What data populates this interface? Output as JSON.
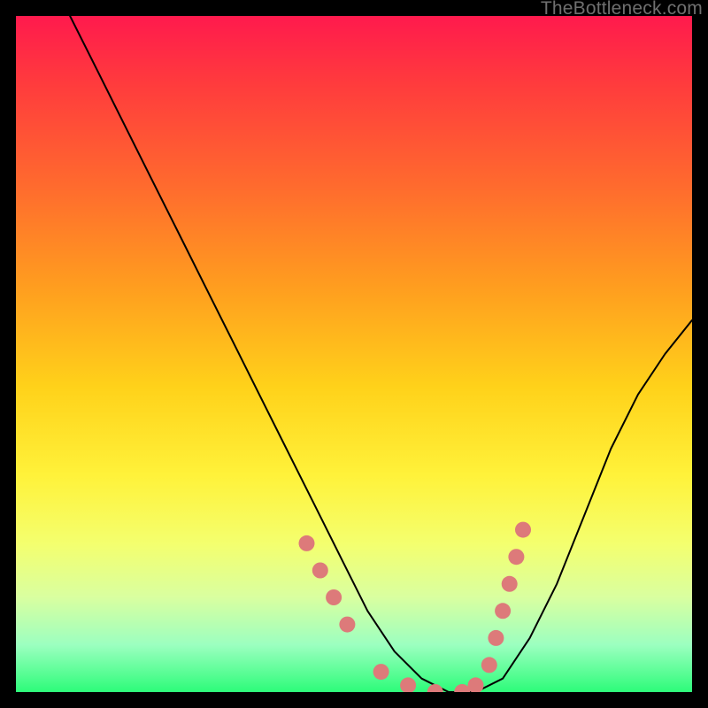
{
  "watermark": "TheBottleneck.com",
  "chart_data": {
    "type": "line",
    "title": "",
    "xlabel": "",
    "ylabel": "",
    "xlim": [
      0,
      100
    ],
    "ylim": [
      0,
      100
    ],
    "series": [
      {
        "name": "curve",
        "x": [
          8,
          12,
          16,
          20,
          24,
          28,
          32,
          36,
          40,
          44,
          48,
          52,
          56,
          60,
          64,
          68,
          72,
          76,
          80,
          84,
          88,
          92,
          96,
          100
        ],
        "y": [
          100,
          92,
          84,
          76,
          68,
          60,
          52,
          44,
          36,
          28,
          20,
          12,
          6,
          2,
          0,
          0,
          2,
          8,
          16,
          26,
          36,
          44,
          50,
          55
        ]
      }
    ],
    "markers": {
      "name": "highlight-dots",
      "color": "#dd7a7a",
      "x": [
        43,
        45,
        47,
        49,
        54,
        58,
        62,
        66,
        68,
        70,
        71,
        72,
        73,
        74,
        75
      ],
      "y": [
        22,
        18,
        14,
        10,
        3,
        1,
        0,
        0,
        1,
        4,
        8,
        12,
        16,
        20,
        24
      ]
    },
    "gradient_stops": [
      {
        "pos": 0,
        "color": "#ff1a4d"
      },
      {
        "pos": 25,
        "color": "#ff6a2e"
      },
      {
        "pos": 55,
        "color": "#ffd21a"
      },
      {
        "pos": 78,
        "color": "#f4ff6e"
      },
      {
        "pos": 100,
        "color": "#2dfc79"
      }
    ]
  }
}
